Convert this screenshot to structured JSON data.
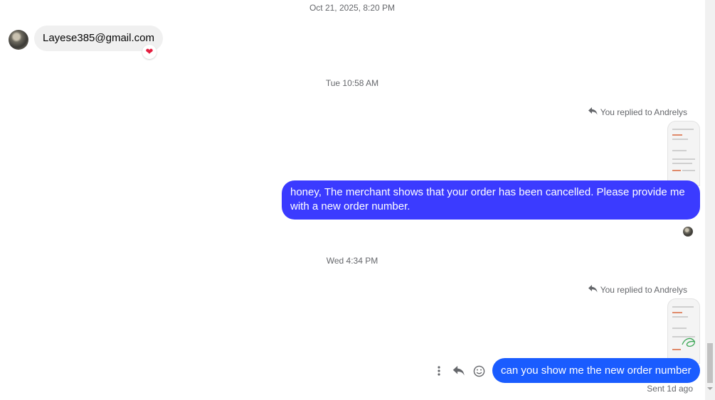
{
  "conversation": {
    "contact_name": "Andrelys",
    "messages": [
      {
        "timestamp": "Oct 21, 2025, 8:20 PM",
        "sender": "them",
        "text": "Layese385@gmail.com",
        "reaction": "❤"
      },
      {
        "timestamp": "Tue 10:58 AM",
        "reply_label": "You replied to Andrelys",
        "sender": "me",
        "text": "honey, The merchant shows that your order has been cancelled. Please provide me with a new order number.",
        "bubble_color": "#3b3bff"
      },
      {
        "timestamp": "Wed 4:34 PM",
        "reply_label": "You replied to Andrelys",
        "sender": "me",
        "text": "can you show me the new order number",
        "bubble_color": "#1a5cff",
        "status": "Sent 1d ago"
      }
    ]
  },
  "message_actions": {
    "more_icon": "more-vertical-icon",
    "reply_icon": "reply-icon",
    "react_icon": "smiley-icon"
  },
  "colors": {
    "timestamp": "#65676b",
    "incoming_bubble": "#f0f0f0"
  }
}
